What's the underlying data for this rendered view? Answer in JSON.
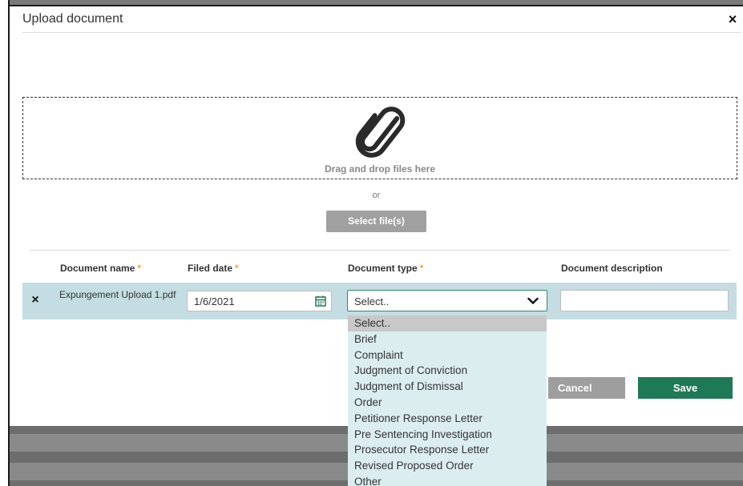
{
  "dialog": {
    "title": "Upload document",
    "close_label": "×"
  },
  "upload": {
    "drop_text": "Drag and drop files here",
    "or_text": "or",
    "select_files_label": "Select file(s)"
  },
  "table": {
    "headers": {
      "document_name": "Document name",
      "filed_date": "Filed date",
      "document_type": "Document type",
      "document_description": "Document description",
      "required_mark": "*"
    },
    "row": {
      "remove_label": "×",
      "document_name": "Expungement Upload 1.pdf",
      "filed_date": "1/6/2021",
      "document_type": "Select..",
      "document_description": ""
    }
  },
  "dropdown": {
    "options": [
      "Select..",
      "Brief",
      "Complaint",
      "Judgment of Conviction",
      "Judgment of Dismissal",
      "Order",
      "Petitioner Response Letter",
      "Pre Sentencing Investigation",
      "Prosecutor Response Letter",
      "Revised Proposed Order",
      "Other"
    ],
    "selected_index": 0
  },
  "actions": {
    "cancel_label": "Cancel",
    "save_label": "Save"
  },
  "icons": {
    "close": "close-icon",
    "paperclip": "paperclip-icon",
    "calendar": "calendar-icon",
    "chevron": "chevron-down-icon",
    "remove": "remove-icon"
  },
  "colors": {
    "accent_green": "#1e7a55",
    "row_highlight": "#c4dde3",
    "dropdown_bg": "#dcedf0",
    "required_star": "#f0a23c",
    "button_gray": "#9e9e9e"
  }
}
